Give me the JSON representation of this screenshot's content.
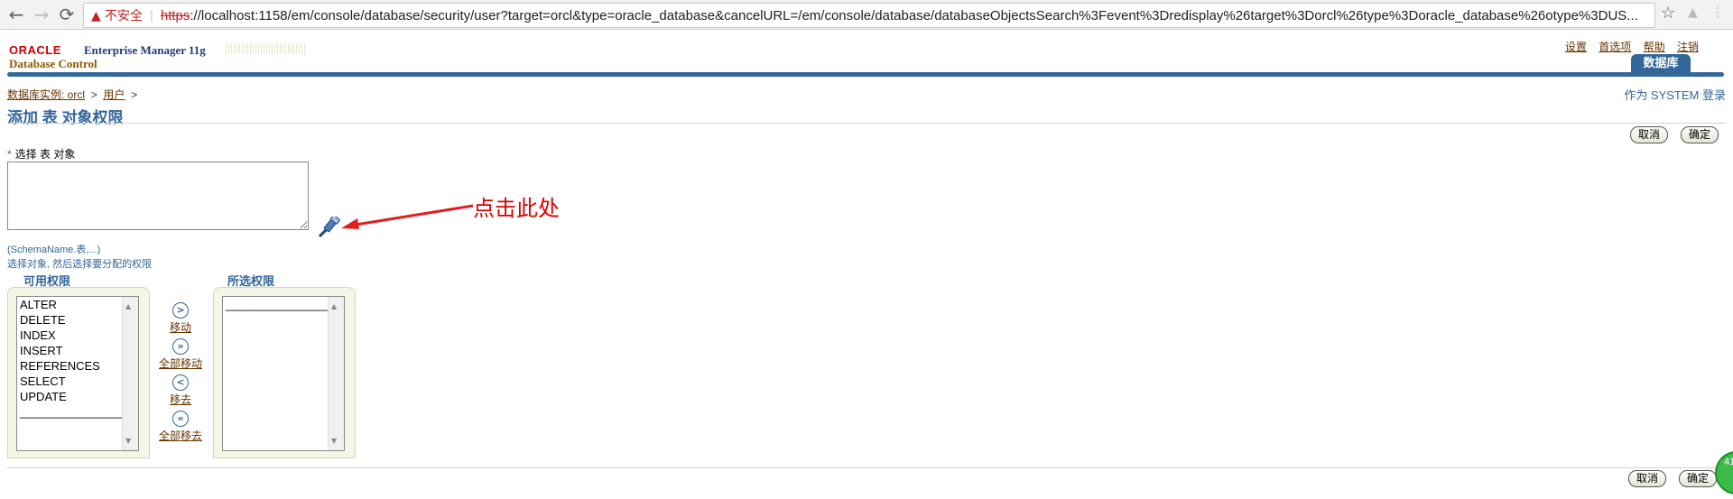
{
  "browser": {
    "back": "←",
    "forward": "→",
    "reload": "⟳",
    "security_icon": "warning-triangle-icon",
    "security_label": "不安全",
    "url_scheme": "https",
    "url_rest": "://localhost:1158/em/console/database/security/user?target=orcl&type=oracle_database&cancelURL=/em/console/database/databaseObjectsSearch%3Fevent%3Dredisplay%26target%3Dorcl%26type%3Doracle_database%26otype%3DUS..."
  },
  "header": {
    "oracle": "ORACLE",
    "em_title": "Enterprise Manager 11g",
    "db_control": "Database Control",
    "links": [
      "设置",
      "首选项",
      "帮助",
      "注销"
    ],
    "tab": "数据库"
  },
  "breadcrumb": {
    "instance": "数据库实例: orcl",
    "sep": ">",
    "users": "用户",
    "sep2": ">"
  },
  "login_as": "作为 SYSTEM 登录",
  "page_title": "添加 表 对象权限",
  "buttons": {
    "cancel": "取消",
    "ok": "确定"
  },
  "select_label": "选择 表 对象",
  "required_mark": "*",
  "hint_format": "(SchemaName.表,...)",
  "hint_text": "选择对象, 然后选择要分配的权限",
  "annotation": "点击此处",
  "available": {
    "label": "可用权限",
    "items": [
      "ALTER",
      "DELETE",
      "INDEX",
      "INSERT",
      "REFERENCES",
      "SELECT",
      "UPDATE",
      "________________"
    ]
  },
  "selected": {
    "label": "所选权限",
    "items": [
      "________________"
    ]
  },
  "move": {
    "move": "移动",
    "move_all": "全部移动",
    "remove": "移去",
    "remove_all": "全部移去"
  },
  "badge": "41"
}
